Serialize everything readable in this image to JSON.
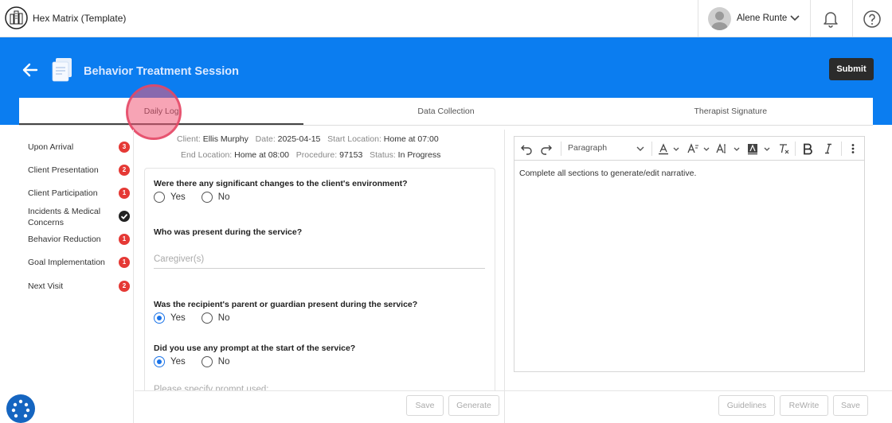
{
  "app": {
    "title": "Hex Matrix (Template)"
  },
  "user": {
    "name": "Alene Runte"
  },
  "header": {
    "title": "Behavior Treatment Session",
    "submit_label": "Submit"
  },
  "tabs": [
    {
      "label": "Daily Log",
      "active": true
    },
    {
      "label": "Data Collection",
      "active": false
    },
    {
      "label": "Therapist Signature",
      "active": false
    }
  ],
  "sidebar": {
    "items": [
      {
        "label": "Upon Arrival",
        "badge": "3",
        "status": "count"
      },
      {
        "label": "Client Presentation",
        "badge": "2",
        "status": "count"
      },
      {
        "label": "Client Participation",
        "badge": "1",
        "status": "count"
      },
      {
        "label": "Incidents & Medical Concerns",
        "badge": "",
        "status": "complete"
      },
      {
        "label": "Behavior Reduction",
        "badge": "1",
        "status": "count"
      },
      {
        "label": "Goal Implementation",
        "badge": "1",
        "status": "count"
      },
      {
        "label": "Next Visit",
        "badge": "2",
        "status": "count"
      }
    ]
  },
  "session": {
    "client_label": "Client:",
    "client": "Ellis Murphy",
    "date_label": "Date:",
    "date": "2025-04-15",
    "start_label": "Start Location:",
    "start": "Home at 07:00",
    "end_label": "End Location:",
    "end": "Home at 08:00",
    "procedure_label": "Procedure:",
    "procedure": "97153",
    "status_label": "Status:",
    "status": "In Progress"
  },
  "form": {
    "q1": "Were there any significant changes to the client's environment?",
    "q2": "Who was present during the service?",
    "q2_placeholder": "Caregiver(s)",
    "q3": "Was the recipient's parent or guardian present during the service?",
    "q4": "Did you use any prompt at the start of the service?",
    "q5_placeholder": "Please specify prompt used:",
    "yes": "Yes",
    "no": "No",
    "answers": {
      "q1": "none",
      "q3": "yes",
      "q4": "yes"
    }
  },
  "mid_footer": {
    "save": "Save",
    "generate": "Generate"
  },
  "editor": {
    "paragraph": "Paragraph",
    "content": "Complete all sections to generate/edit narrative."
  },
  "right_footer": {
    "guidelines": "Guidelines",
    "rewrite": "ReWrite",
    "save": "Save"
  },
  "colors": {
    "primary": "#0b7df0",
    "badge": "#e53935",
    "radio": "#1a73e8",
    "highlight": "#f05a78"
  },
  "icons": [
    "hex-matrix-logo",
    "user-avatar",
    "chevron-down-icon",
    "bell-icon",
    "help-icon",
    "back-arrow-icon",
    "document-icon",
    "undo-icon",
    "redo-icon",
    "font-color-icon",
    "font-size-icon",
    "text-style-icon",
    "highlight-icon",
    "clear-format-icon",
    "bold-icon",
    "italic-icon",
    "more-vertical-icon",
    "accessibility-fab-icon"
  ]
}
